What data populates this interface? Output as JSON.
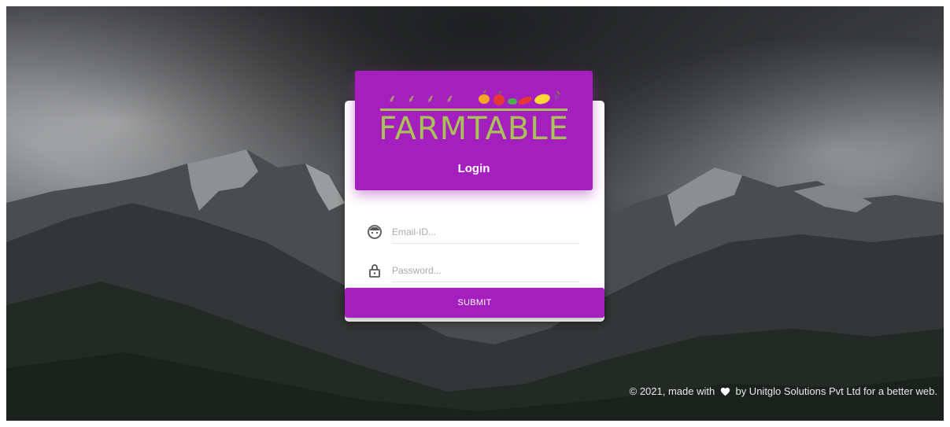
{
  "login": {
    "brand_text": "FARMTABLE",
    "title": "Login",
    "email": {
      "placeholder": "Email-ID..."
    },
    "password": {
      "placeholder": "Password..."
    },
    "submit_label": "SUBMIT"
  },
  "footer": {
    "prefix": "© 2021, made with",
    "icon": "heart-icon",
    "suffix": "by Unitglo Solutions Pvt Ltd for a better web."
  },
  "colors": {
    "accent": "#a51fbf",
    "logo_green": "#a8c256",
    "background": "#2a2c2e"
  },
  "icons": {
    "email": "face-icon",
    "password": "lock-icon"
  }
}
